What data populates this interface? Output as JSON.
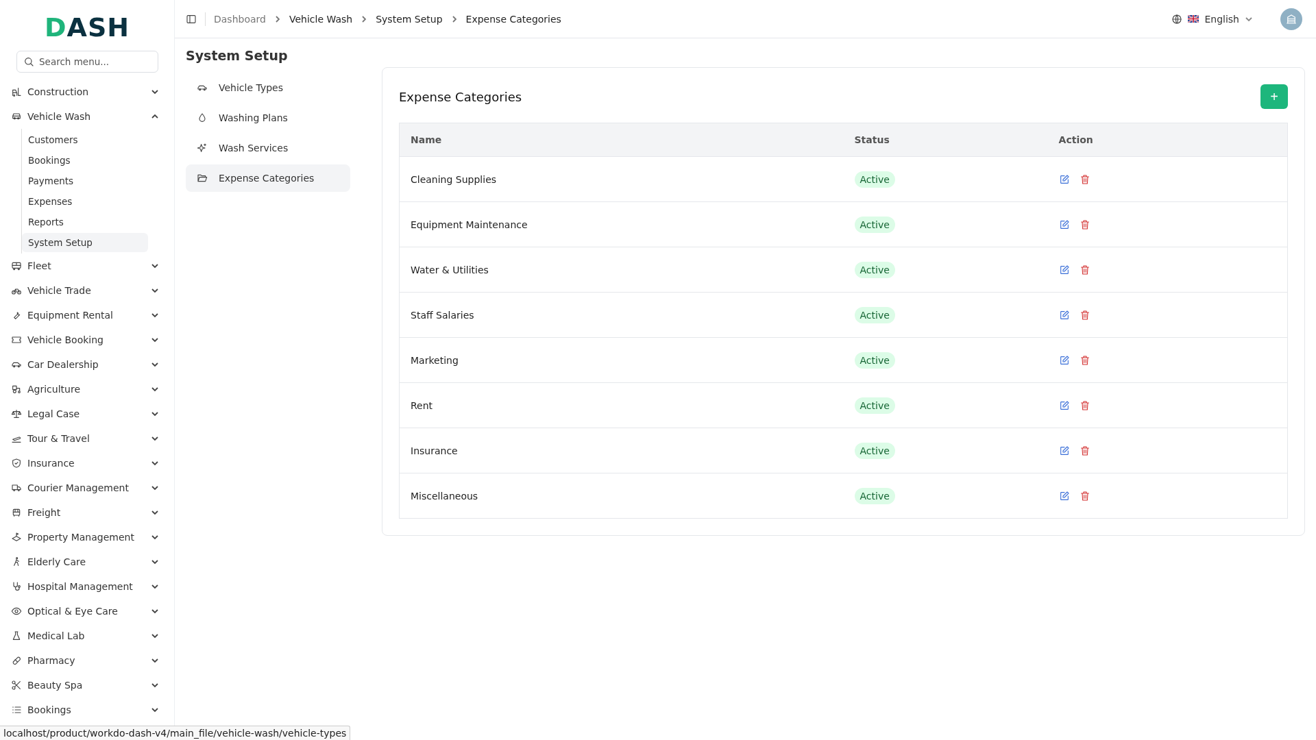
{
  "logo": "DASH",
  "search": {
    "placeholder": "Search menu..."
  },
  "sidebar": {
    "items": [
      {
        "label": "Construction",
        "expanded": false
      },
      {
        "label": "Vehicle Wash",
        "expanded": true,
        "children": [
          {
            "label": "Customers",
            "selected": false
          },
          {
            "label": "Bookings",
            "selected": false
          },
          {
            "label": "Payments",
            "selected": false
          },
          {
            "label": "Expenses",
            "selected": false
          },
          {
            "label": "Reports",
            "selected": false
          },
          {
            "label": "System Setup",
            "selected": true
          }
        ]
      },
      {
        "label": "Fleet",
        "expanded": false
      },
      {
        "label": "Vehicle Trade",
        "expanded": false
      },
      {
        "label": "Equipment Rental",
        "expanded": false
      },
      {
        "label": "Vehicle Booking",
        "expanded": false
      },
      {
        "label": "Car Dealership",
        "expanded": false
      },
      {
        "label": "Agriculture",
        "expanded": false
      },
      {
        "label": "Legal Case",
        "expanded": false
      },
      {
        "label": "Tour & Travel",
        "expanded": false
      },
      {
        "label": "Insurance",
        "expanded": false
      },
      {
        "label": "Courier Management",
        "expanded": false
      },
      {
        "label": "Freight",
        "expanded": false
      },
      {
        "label": "Property Management",
        "expanded": false
      },
      {
        "label": "Elderly Care",
        "expanded": false
      },
      {
        "label": "Hospital Management",
        "expanded": false
      },
      {
        "label": "Optical & Eye Care",
        "expanded": false
      },
      {
        "label": "Medical Lab",
        "expanded": false
      },
      {
        "label": "Pharmacy",
        "expanded": false
      },
      {
        "label": "Beauty Spa",
        "expanded": false
      },
      {
        "label": "Bookings",
        "expanded": false
      }
    ]
  },
  "breadcrumb": [
    "Dashboard",
    "Vehicle Wash",
    "System Setup",
    "Expense Categories"
  ],
  "language": "English",
  "page_title": "System Setup",
  "subnav": [
    {
      "label": "Vehicle Types",
      "selected": false
    },
    {
      "label": "Washing Plans",
      "selected": false
    },
    {
      "label": "Wash Services",
      "selected": false
    },
    {
      "label": "Expense Categories",
      "selected": true
    }
  ],
  "card": {
    "title": "Expense Categories",
    "add_button": "+"
  },
  "table": {
    "columns": [
      "Name",
      "Status",
      "Action"
    ],
    "rows": [
      {
        "name": "Cleaning Supplies",
        "status": "Active"
      },
      {
        "name": "Equipment Maintenance",
        "status": "Active"
      },
      {
        "name": "Water & Utilities",
        "status": "Active"
      },
      {
        "name": "Staff Salaries",
        "status": "Active"
      },
      {
        "name": "Marketing",
        "status": "Active"
      },
      {
        "name": "Rent",
        "status": "Active"
      },
      {
        "name": "Insurance",
        "status": "Active"
      },
      {
        "name": "Miscellaneous",
        "status": "Active"
      }
    ]
  },
  "status_url": "localhost/product/workdo-dash-v4/main_file/vehicle-wash/vehicle-types"
}
